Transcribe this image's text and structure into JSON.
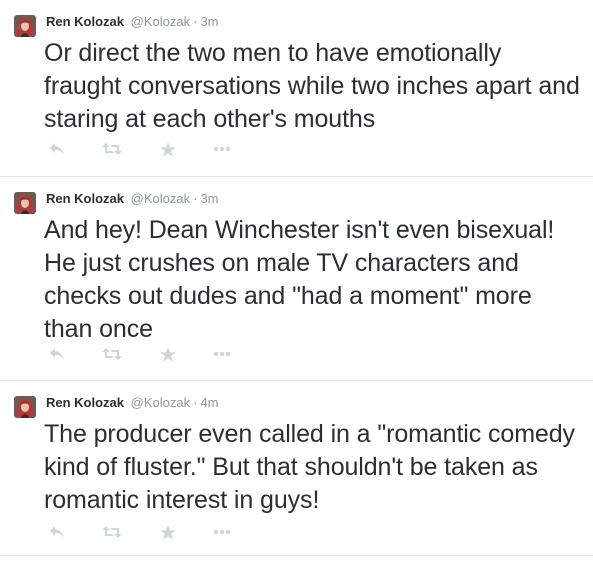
{
  "colors": {
    "text": "#292f33",
    "meta": "#8899a6",
    "icon": "#ccd6dd",
    "divider": "#e1e8ed",
    "avatar_bg": "#b23a3a"
  },
  "icons": {
    "reply": "reply-icon",
    "retweet": "retweet-icon",
    "favorite": "star-icon",
    "more": "more-icon"
  },
  "tweets": [
    {
      "fullname": "Ren Kolozak",
      "handle": "@Kolozak",
      "dot": "·",
      "time": "3m",
      "text": "Or direct the two men to have emotionally fraught conversations while two inches apart and staring at each other's mouths"
    },
    {
      "fullname": "Ren Kolozak",
      "handle": "@Kolozak",
      "dot": "·",
      "time": "3m",
      "text": "And hey! Dean Winchester isn't even bisexual! He just crushes on male TV characters and checks out dudes and \"had a moment\" more than once"
    },
    {
      "fullname": "Ren Kolozak",
      "handle": "@Kolozak",
      "dot": "·",
      "time": "4m",
      "text": "The producer even called in a \"romantic comedy kind of fluster.\" But that shouldn't be taken as romantic interest in guys!"
    }
  ]
}
